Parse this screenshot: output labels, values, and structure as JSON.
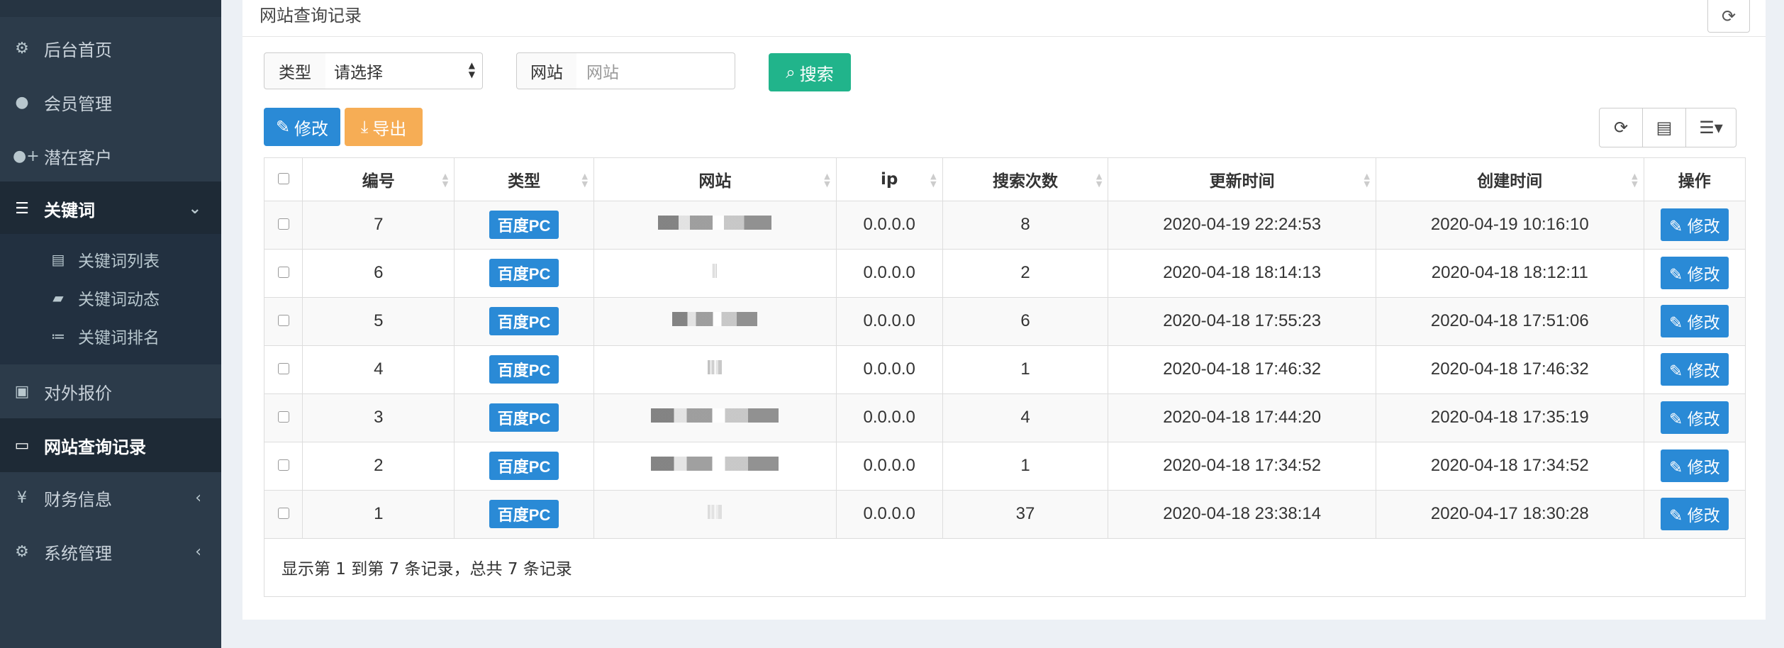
{
  "sidebar": {
    "items": [
      {
        "label": "后台首页",
        "icon": "cogs-icon"
      },
      {
        "label": "会员管理",
        "icon": "user-icon"
      },
      {
        "label": "潜在客户",
        "icon": "user-plus-icon"
      },
      {
        "label": "关键词",
        "icon": "bars-icon",
        "expanded": true
      },
      {
        "label": "对外报价",
        "icon": "money-icon"
      },
      {
        "label": "网站查询记录",
        "icon": "desktop-icon",
        "active": true
      },
      {
        "label": "财务信息",
        "icon": "yen-icon"
      },
      {
        "label": "系统管理",
        "icon": "cogs-icon"
      }
    ],
    "subitems": [
      {
        "label": "关键词列表",
        "icon": "list-alt-icon"
      },
      {
        "label": "关键词动态",
        "icon": "book-icon"
      },
      {
        "label": "关键词排名",
        "icon": "list-ol-icon"
      }
    ]
  },
  "panel": {
    "title": "网站查询记录"
  },
  "search": {
    "type_label": "类型",
    "type_value": "请选择",
    "site_label": "网站",
    "site_placeholder": "网站",
    "search_button": "搜索"
  },
  "actions": {
    "edit": "修改",
    "export": "导出"
  },
  "table": {
    "headers": [
      "编号",
      "类型",
      "网站",
      "ip",
      "搜索次数",
      "更新时间",
      "创建时间",
      "操作"
    ],
    "rows": [
      {
        "id": "7",
        "type": "百度PC",
        "ip": "0.0.0.0",
        "count": "8",
        "updated": "2020-04-19 22:24:53",
        "created": "2020-04-19 10:16:10",
        "action": "修改"
      },
      {
        "id": "6",
        "type": "百度PC",
        "ip": "0.0.0.0",
        "count": "2",
        "updated": "2020-04-18 18:14:13",
        "created": "2020-04-18 18:12:11",
        "action": "修改"
      },
      {
        "id": "5",
        "type": "百度PC",
        "ip": "0.0.0.0",
        "count": "6",
        "updated": "2020-04-18 17:55:23",
        "created": "2020-04-18 17:51:06",
        "action": "修改"
      },
      {
        "id": "4",
        "type": "百度PC",
        "ip": "0.0.0.0",
        "count": "1",
        "updated": "2020-04-18 17:46:32",
        "created": "2020-04-18 17:46:32",
        "action": "修改"
      },
      {
        "id": "3",
        "type": "百度PC",
        "ip": "0.0.0.0",
        "count": "4",
        "updated": "2020-04-18 17:44:20",
        "created": "2020-04-18 17:35:19",
        "action": "修改"
      },
      {
        "id": "2",
        "type": "百度PC",
        "ip": "0.0.0.0",
        "count": "1",
        "updated": "2020-04-18 17:34:52",
        "created": "2020-04-18 17:34:52",
        "action": "修改"
      },
      {
        "id": "1",
        "type": "百度PC",
        "ip": "0.0.0.0",
        "count": "37",
        "updated": "2020-04-18 23:38:14",
        "created": "2020-04-17 18:30:28",
        "action": "修改"
      }
    ],
    "footer": "显示第 1 到第 7 条记录，总共 7 条记录"
  },
  "colors": {
    "sidebar_bg": "#2c3b4a",
    "primary": "#2a8ad6",
    "success": "#21b48b",
    "warning": "#f6ad55"
  }
}
